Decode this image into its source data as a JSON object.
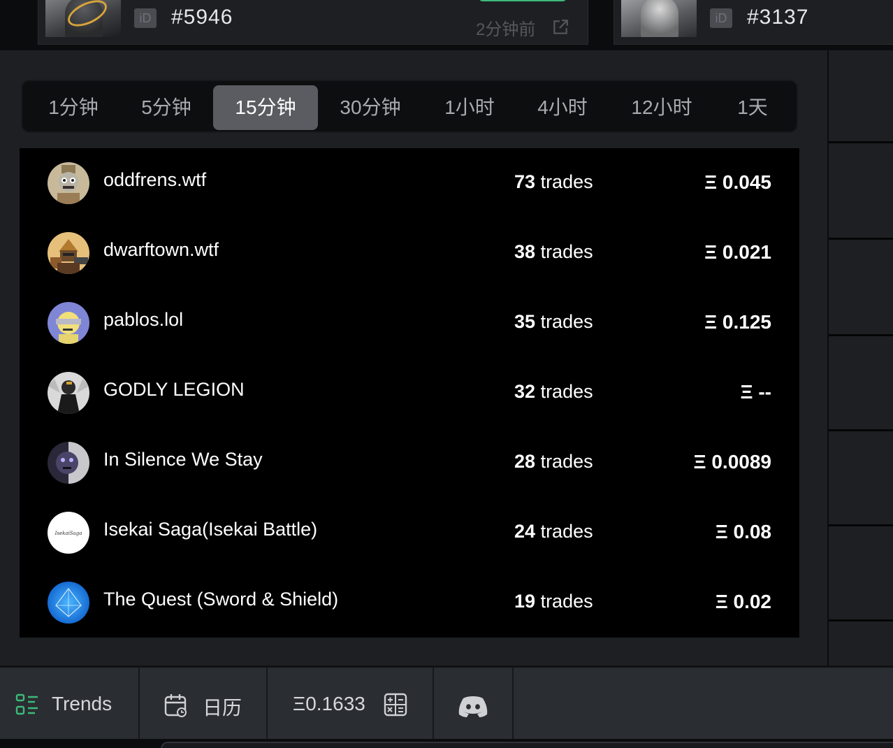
{
  "top_cards": [
    {
      "id_badge": "iD",
      "id_number": "#5946",
      "time_ago": "2分钟前",
      "icon": "external-link-icon"
    },
    {
      "id_badge": "iD",
      "id_number": "#3137"
    }
  ],
  "timeframes": {
    "tabs": [
      "1分钟",
      "5分钟",
      "15分钟",
      "30分钟",
      "1小时",
      "4小时",
      "12小时",
      "1天"
    ],
    "active": "15分钟"
  },
  "collections": [
    {
      "name": "oddfrens.wtf",
      "trades_count": "73",
      "trades_unit": "trades",
      "price": "Ξ 0.045"
    },
    {
      "name": "dwarftown.wtf",
      "trades_count": "38",
      "trades_unit": "trades",
      "price": "Ξ 0.021"
    },
    {
      "name": "pablos.lol",
      "trades_count": "35",
      "trades_unit": "trades",
      "price": "Ξ 0.125"
    },
    {
      "name": "GODLY LEGION",
      "trades_count": "32",
      "trades_unit": "trades",
      "price": "Ξ --"
    },
    {
      "name": "In Silence We Stay",
      "trades_count": "28",
      "trades_unit": "trades",
      "price": "Ξ 0.0089"
    },
    {
      "name": "Isekai Saga(Isekai Battle)",
      "trades_count": "24",
      "trades_unit": "trades",
      "price": "Ξ 0.08",
      "avatar_text": "IsekaiSaga"
    },
    {
      "name": "The Quest (Sword & Shield)",
      "trades_count": "19",
      "trades_unit": "trades",
      "price": "Ξ 0.02"
    }
  ],
  "bottom_bar": {
    "trends_label": "Trends",
    "calendar_label": "日历",
    "gas_value": "Ξ0.1633",
    "icons": [
      "trends-icon",
      "calendar-icon",
      "calculator-icon",
      "discord-icon"
    ]
  },
  "colors": {
    "panel_bg": "#1d1f23",
    "list_bg": "#000000",
    "active_tab": "#5a5c61",
    "accent_green": "#3cba7a"
  }
}
